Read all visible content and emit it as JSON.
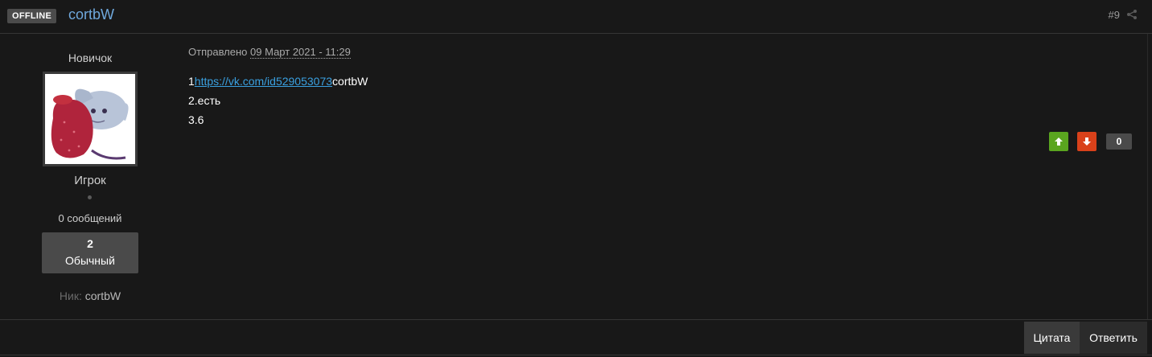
{
  "header": {
    "status": "OFFLINE",
    "author": "cortbW",
    "post_number": "#9",
    "share_icon": "share-icon"
  },
  "author_panel": {
    "rank_title": "Новичок",
    "group": "Игрок",
    "post_count": "0 сообщений",
    "reputation_value": "2",
    "reputation_label": "Обычный",
    "nick_label": "Ник:",
    "nick_value": "cortbW"
  },
  "post": {
    "meta_label": "Отправлено",
    "date": "09 Март 2021 - 11:29",
    "line1_prefix": "1",
    "line1_link": "https://vk.com/id529053073",
    "line1_suffix": "cortbW",
    "line2": "2.есть",
    "line3": "3.6"
  },
  "rating": {
    "count": "0",
    "up_color": "#5aa51f",
    "down_color": "#d9411a"
  },
  "footer": {
    "quote_label": "Цитата",
    "reply_label": "Ответить"
  }
}
